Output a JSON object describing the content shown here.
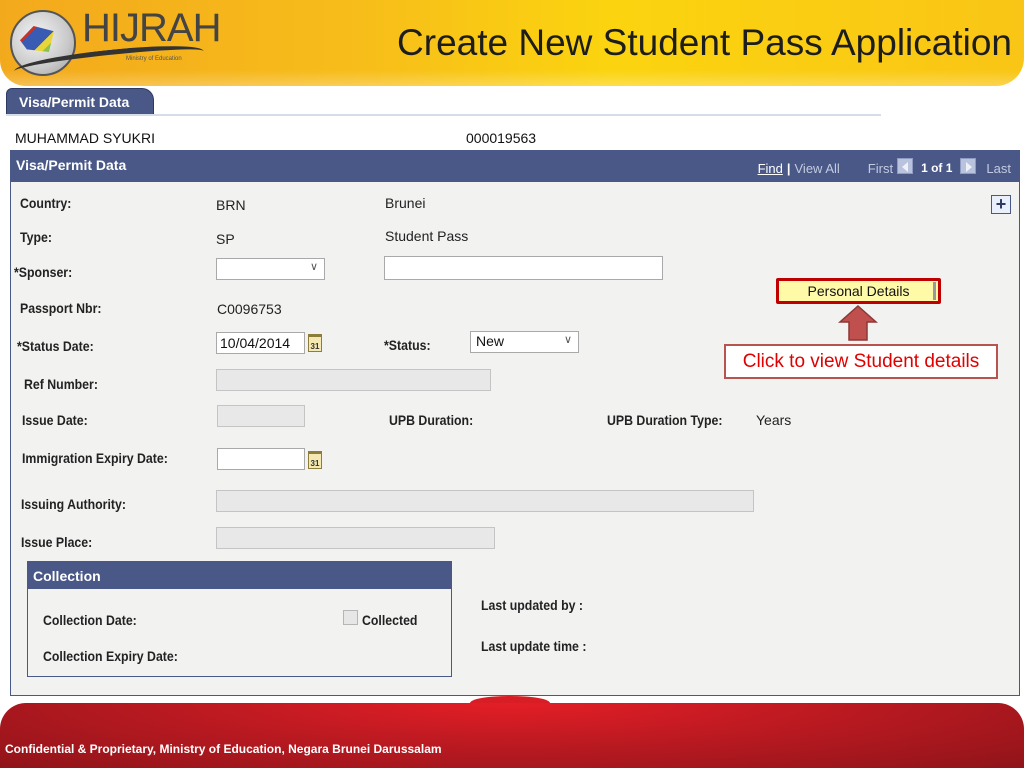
{
  "header": {
    "logo_text": "HIJRAH",
    "logo_tm": "™",
    "logo_subtitle": "Ministry of Education",
    "slide_title": "Create New Student Pass Application"
  },
  "tab": {
    "label": "Visa/Permit Data"
  },
  "person": {
    "name": "MUHAMMAD SYUKRI",
    "id": "000019563"
  },
  "panel": {
    "title": "Visa/Permit Data",
    "nav": {
      "find": "Find",
      "separator": "|",
      "view_all": "View All",
      "first": "First",
      "count": "1 of 1",
      "last": "Last"
    },
    "add_button": "+"
  },
  "form": {
    "country": {
      "label": "Country:",
      "code": "BRN",
      "name": "Brunei"
    },
    "type": {
      "label": "Type:",
      "code": "SP",
      "name": "Student Pass"
    },
    "sponser": {
      "label": "*Sponser:",
      "select_value": "",
      "text_value": ""
    },
    "passport": {
      "label": "Passport Nbr:",
      "value": "C0096753"
    },
    "status_date": {
      "label": "*Status Date:",
      "value": "10/04/2014",
      "calendar_icon": "31"
    },
    "status": {
      "label": "*Status:",
      "value": "New"
    },
    "ref_number": {
      "label": "Ref Number:",
      "value": ""
    },
    "issue_date": {
      "label": "Issue Date:",
      "value": ""
    },
    "upb_duration": {
      "label": "UPB Duration:",
      "value": ""
    },
    "upb_duration_type": {
      "label": "UPB Duration Type:",
      "value": "Years"
    },
    "immigration_expiry": {
      "label": "Immigration Expiry Date:",
      "value": "",
      "calendar_icon": "31"
    },
    "issuing_authority": {
      "label": "Issuing Authority:",
      "value": ""
    },
    "issue_place": {
      "label": "Issue Place:",
      "value": ""
    }
  },
  "personal_details_button": "Personal Details",
  "callout": "Click to view Student details",
  "collection": {
    "title": "Collection",
    "collection_date_label": "Collection Date:",
    "collected_label": "Collected",
    "collected_checked": false,
    "collection_expiry_label": "Collection Expiry Date:"
  },
  "audit": {
    "last_updated_by": "Last updated by :",
    "last_update_time": "Last update time :"
  },
  "footer": {
    "text": "Confidential & Proprietary, Ministry of Education, Negara Brunei Darussalam"
  },
  "colors": {
    "panel_header": "#4a5888",
    "callout_text": "#e00000",
    "button_bg": "#fffaa8",
    "button_border": "#c00000",
    "footer_red": "#c01a22",
    "banner_yellow": "#f7bd1a"
  }
}
